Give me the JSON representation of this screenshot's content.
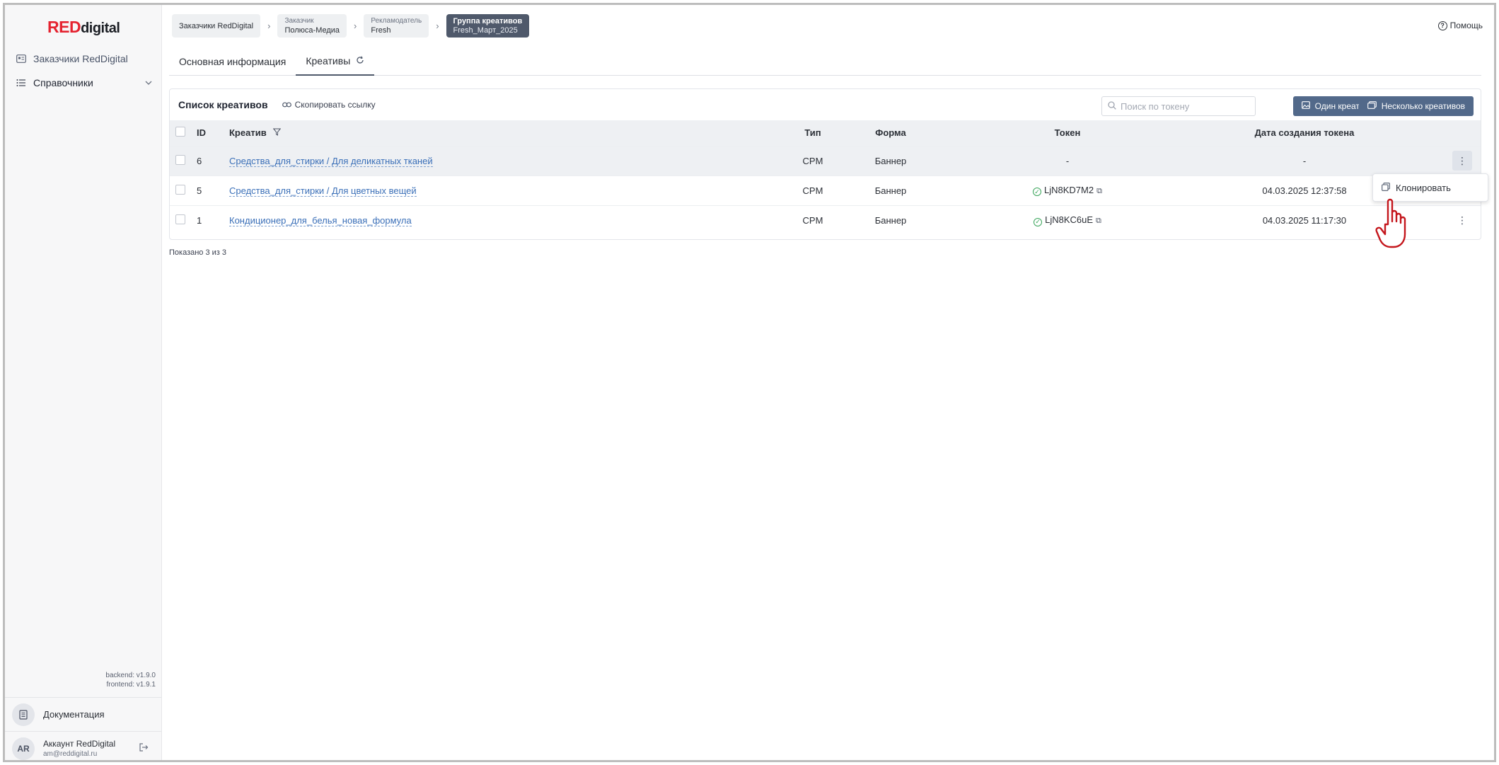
{
  "brand": {
    "red": "RED",
    "rest": "digital",
    "accent": "#e52330"
  },
  "sidebar": {
    "items": [
      {
        "label": "Заказчики RedDigital",
        "icon": "id-card-icon"
      },
      {
        "label": "Справочники",
        "icon": "list-icon"
      }
    ],
    "backend_version": "backend: v1.9.0",
    "frontend_version": "frontend: v1.9.1",
    "docs_label": "Документация",
    "account": {
      "initials": "AR",
      "name": "Аккаунт RedDigital",
      "email": "am@reddigital.ru"
    }
  },
  "breadcrumbs": {
    "c1": "Заказчики RedDigital",
    "c2_small": "Заказчик",
    "c2": "Полюса-Медиа",
    "c3_small": "Рекламодатель",
    "c3": "Fresh",
    "c4_small": "Группа креативов",
    "c4": "Fresh_Март_2025"
  },
  "help_label": "Помощь",
  "tabs": {
    "info": "Основная информация",
    "creatives": "Креативы"
  },
  "list": {
    "title": "Список креативов",
    "copy_link": "Скопировать ссылку",
    "search_placeholder": "Поиск по токену",
    "btn_one": "Один креатив",
    "btn_many": "Несколько креативов",
    "columns": {
      "id": "ID",
      "name": "Креатив",
      "type": "Тип",
      "form": "Форма",
      "token": "Токен",
      "date": "Дата создания токена"
    },
    "rows": [
      {
        "id": "6",
        "name": "Средства_для_стирки / Для деликатных тканей",
        "type": "CPM",
        "form": "Баннер",
        "token": "-",
        "date": "-"
      },
      {
        "id": "5",
        "name": "Средства_для_стирки / Для цветных вещей",
        "type": "CPM",
        "form": "Баннер",
        "token": "LjN8KD7M2",
        "date": "04.03.2025 12:37:58"
      },
      {
        "id": "1",
        "name": "Кондиционер_для_белья_новая_формула",
        "type": "CPM",
        "form": "Баннер",
        "token": "LjN8KC6uE",
        "date": "04.03.2025 11:17:30"
      }
    ],
    "shown": "Показано 3 из 3"
  },
  "context_menu": {
    "clone": "Клонировать"
  }
}
